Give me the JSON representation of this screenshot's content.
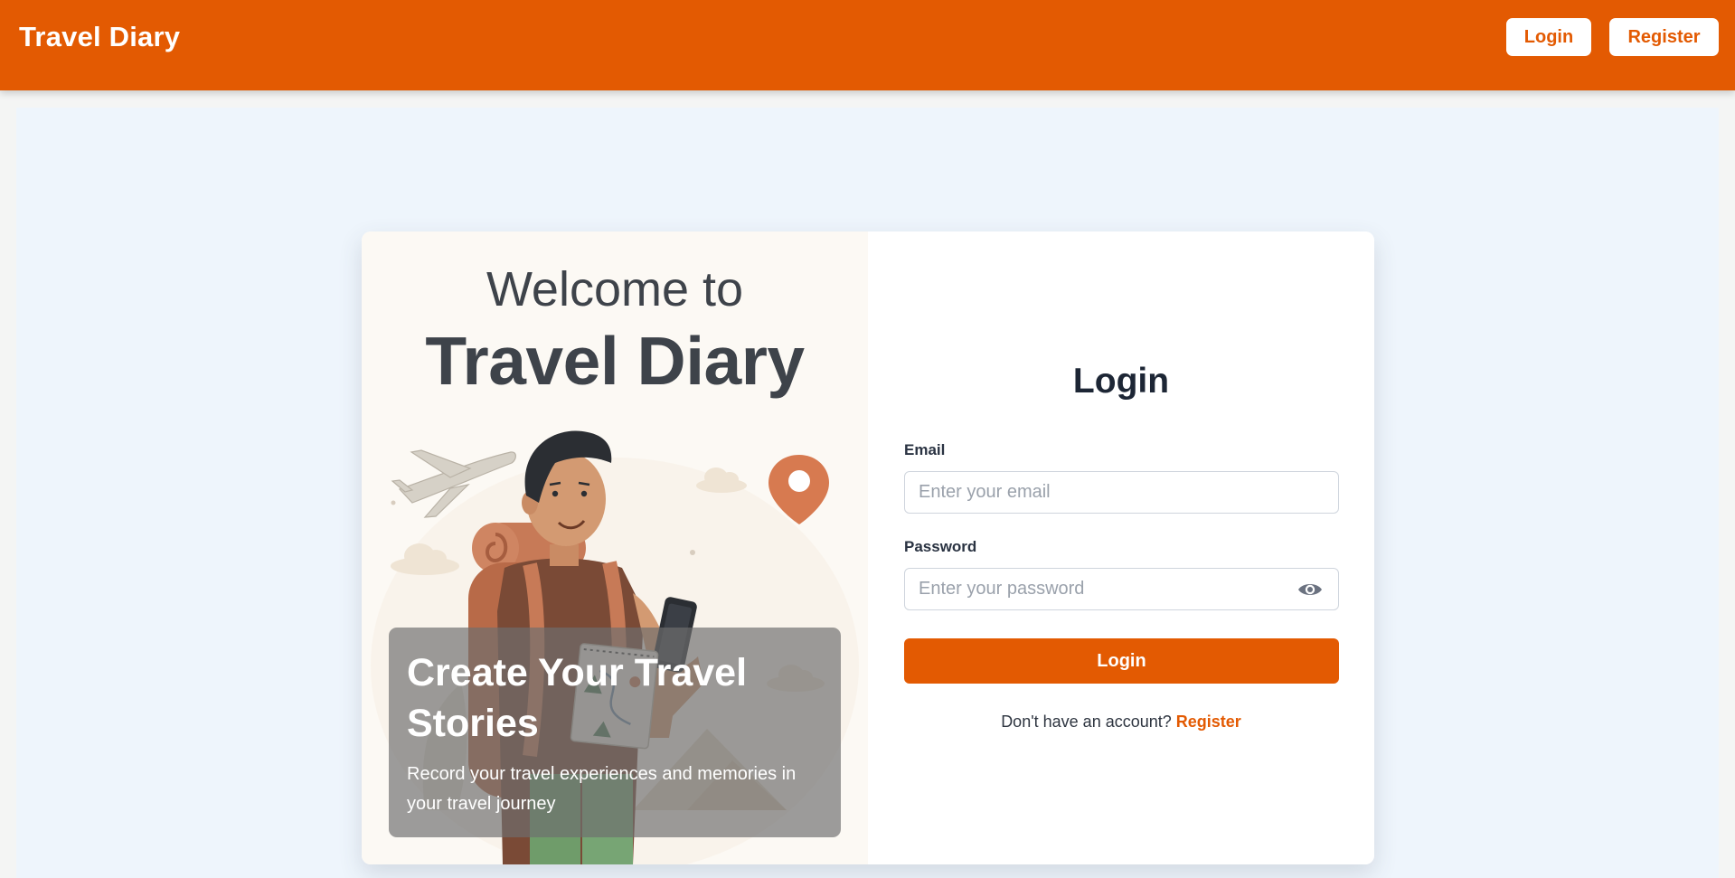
{
  "navbar": {
    "brand": "Travel Diary",
    "login_label": "Login",
    "register_label": "Register"
  },
  "hero": {
    "welcome_line1": "Welcome to",
    "welcome_line2": "Travel Diary",
    "overlay_title": "Create Your Travel Stories",
    "overlay_subtitle": "Record your travel experiences and memories in your travel journey"
  },
  "login_form": {
    "title": "Login",
    "email_label": "Email",
    "email_placeholder": "Enter your email",
    "email_value": "",
    "password_label": "Password",
    "password_placeholder": "Enter your password",
    "password_value": "",
    "submit_label": "Login",
    "footer_prompt": "Don't have an account?",
    "footer_link": "Register"
  },
  "colors": {
    "brand_orange": "#e35a02",
    "page_background": "#eef5fc",
    "text_dark": "#3e434a"
  },
  "icons": {
    "password_toggle": "eye-icon",
    "illustration": "traveler-with-backpack-and-phone"
  }
}
